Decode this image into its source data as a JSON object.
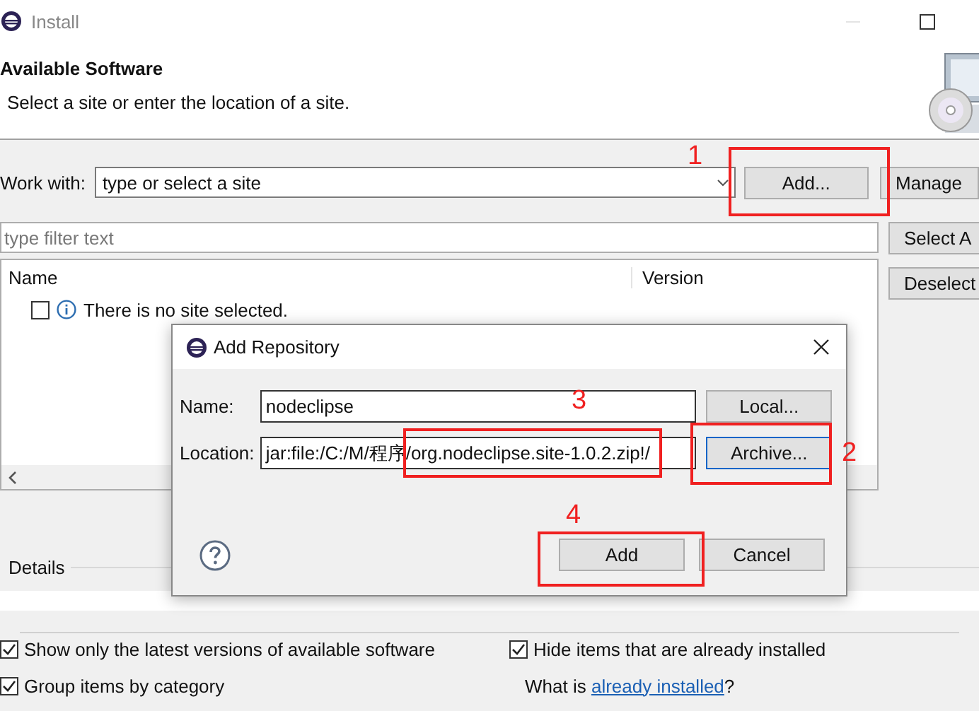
{
  "window": {
    "title": "Install"
  },
  "header": {
    "title": "Available Software",
    "subtitle": "Select a site or enter the location of a site."
  },
  "work_with": {
    "label": "Work with:",
    "placeholder": "type or select a site",
    "add_button": "Add...",
    "manage_button": "Manage"
  },
  "filter": {
    "placeholder": "type filter text"
  },
  "side_buttons": [
    "Select A",
    "Deselect"
  ],
  "table": {
    "columns": [
      "Name",
      "Version"
    ],
    "rows": [
      {
        "text": "There is no site selected.",
        "checked": false
      }
    ]
  },
  "details": {
    "label": "Details"
  },
  "options": [
    {
      "label": "Show only the latest versions of available software",
      "checked": true
    },
    {
      "label": "Hide items that are already installed",
      "checked": true
    },
    {
      "label": "Group items by category",
      "checked": true
    }
  ],
  "installed_hint": {
    "text": "What is ",
    "link": "already installed",
    "suffix": "?"
  },
  "dialog": {
    "title": "Add Repository",
    "fields": [
      {
        "label": "Name:",
        "value": "nodeclipse",
        "button": "Local...",
        "focused": false
      },
      {
        "label": "Location:",
        "value": "jar:file:/C:/M/程序/org.nodeclipse.site-1.0.2.zip!/",
        "button": "Archive...",
        "focused": true
      }
    ],
    "buttons": [
      "Add",
      "Cancel"
    ]
  },
  "annotations": [
    {
      "number": "1"
    },
    {
      "number": "2"
    },
    {
      "number": "3"
    },
    {
      "number": "4"
    }
  ]
}
